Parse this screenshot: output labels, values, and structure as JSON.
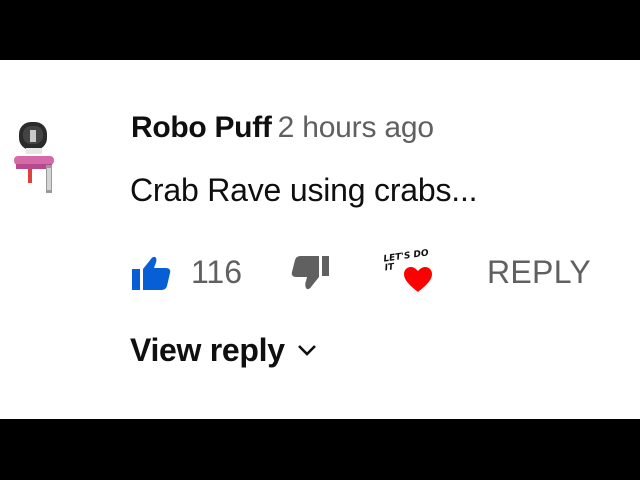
{
  "comment": {
    "author": "Robo Puff",
    "timestamp": "2 hours ago",
    "text": "Crab Rave using crabs...",
    "like_count": "116",
    "reply_label": "REPLY",
    "view_reply_label": "View reply",
    "creator_heart_text": "LET'S DO IT"
  },
  "icons": {
    "like": "thumbs-up-icon",
    "dislike": "thumbs-down-icon",
    "heart": "heart-icon",
    "chevron": "chevron-down-icon"
  },
  "colors": {
    "like_active": "#065fd4",
    "muted_text": "#606060",
    "primary_text": "#0f0f0f",
    "heart": "#ff0000",
    "avatar_accent": "#d66aa8"
  }
}
